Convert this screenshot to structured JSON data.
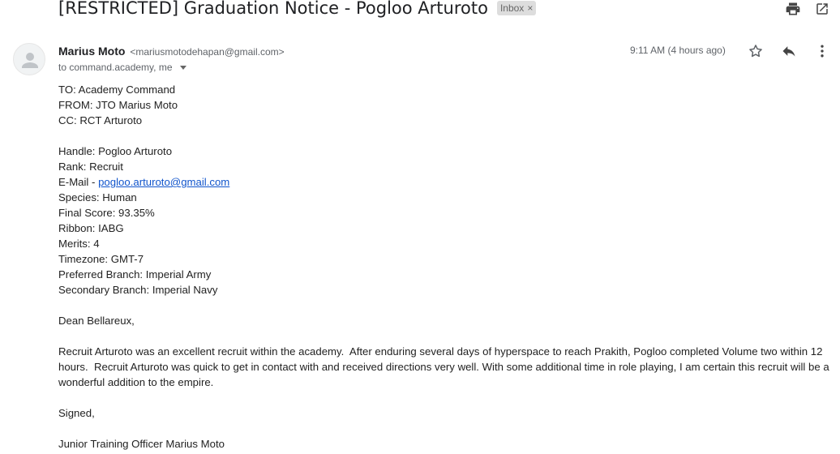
{
  "email": {
    "subject": "[RESTRICTED] Graduation Notice - Pogloo Arturoto",
    "label": "Inbox",
    "sender_name": "Marius Moto",
    "sender_email": "<mariusmotodehapan@gmail.com>",
    "recipients": "to command.academy, me",
    "time": "9:11 AM (4 hours ago)"
  },
  "icons": {
    "print": "print-icon",
    "open_new": "open-in-new-window-icon",
    "star": "star-icon",
    "reply": "reply-icon",
    "more": "more-vertical-icon",
    "avatar": "person-avatar-icon",
    "remove_label": "close-icon",
    "expand": "dropdown-caret-icon"
  },
  "body": {
    "header": {
      "to": "TO: Academy Command",
      "from": "FROM: JTO Marius Moto",
      "cc": "CC: RCT Arturoto"
    },
    "details": {
      "handle": "Handle: Pogloo Arturoto",
      "rank": "Rank: Recruit",
      "email_prefix": "E-Mail - ",
      "email_link": "pogloo.arturoto@gmail.com",
      "species": "Species: Human",
      "final_score": "Final Score: 93.35%",
      "ribbon": "Ribbon: IABG",
      "merits": "Merits: 4",
      "timezone": "Timezone: GMT-7",
      "preferred_branch": "Preferred Branch: Imperial Army",
      "secondary_branch": "Secondary Branch: Imperial Navy"
    },
    "greeting": "Dean Bellareux,",
    "paragraph": "Recruit Arturoto was an excellent recruit within the academy.  After enduring several days of hyperspace to reach Prakith, Pogloo completed Volume two within 12 hours.  Recruit Arturoto was quick to get in contact with and received directions very well. With some additional time in role playing, I am certain this recruit will be a wonderful addition to the empire.",
    "signed": "Signed,",
    "signature": "Junior Training Officer Marius Moto"
  }
}
